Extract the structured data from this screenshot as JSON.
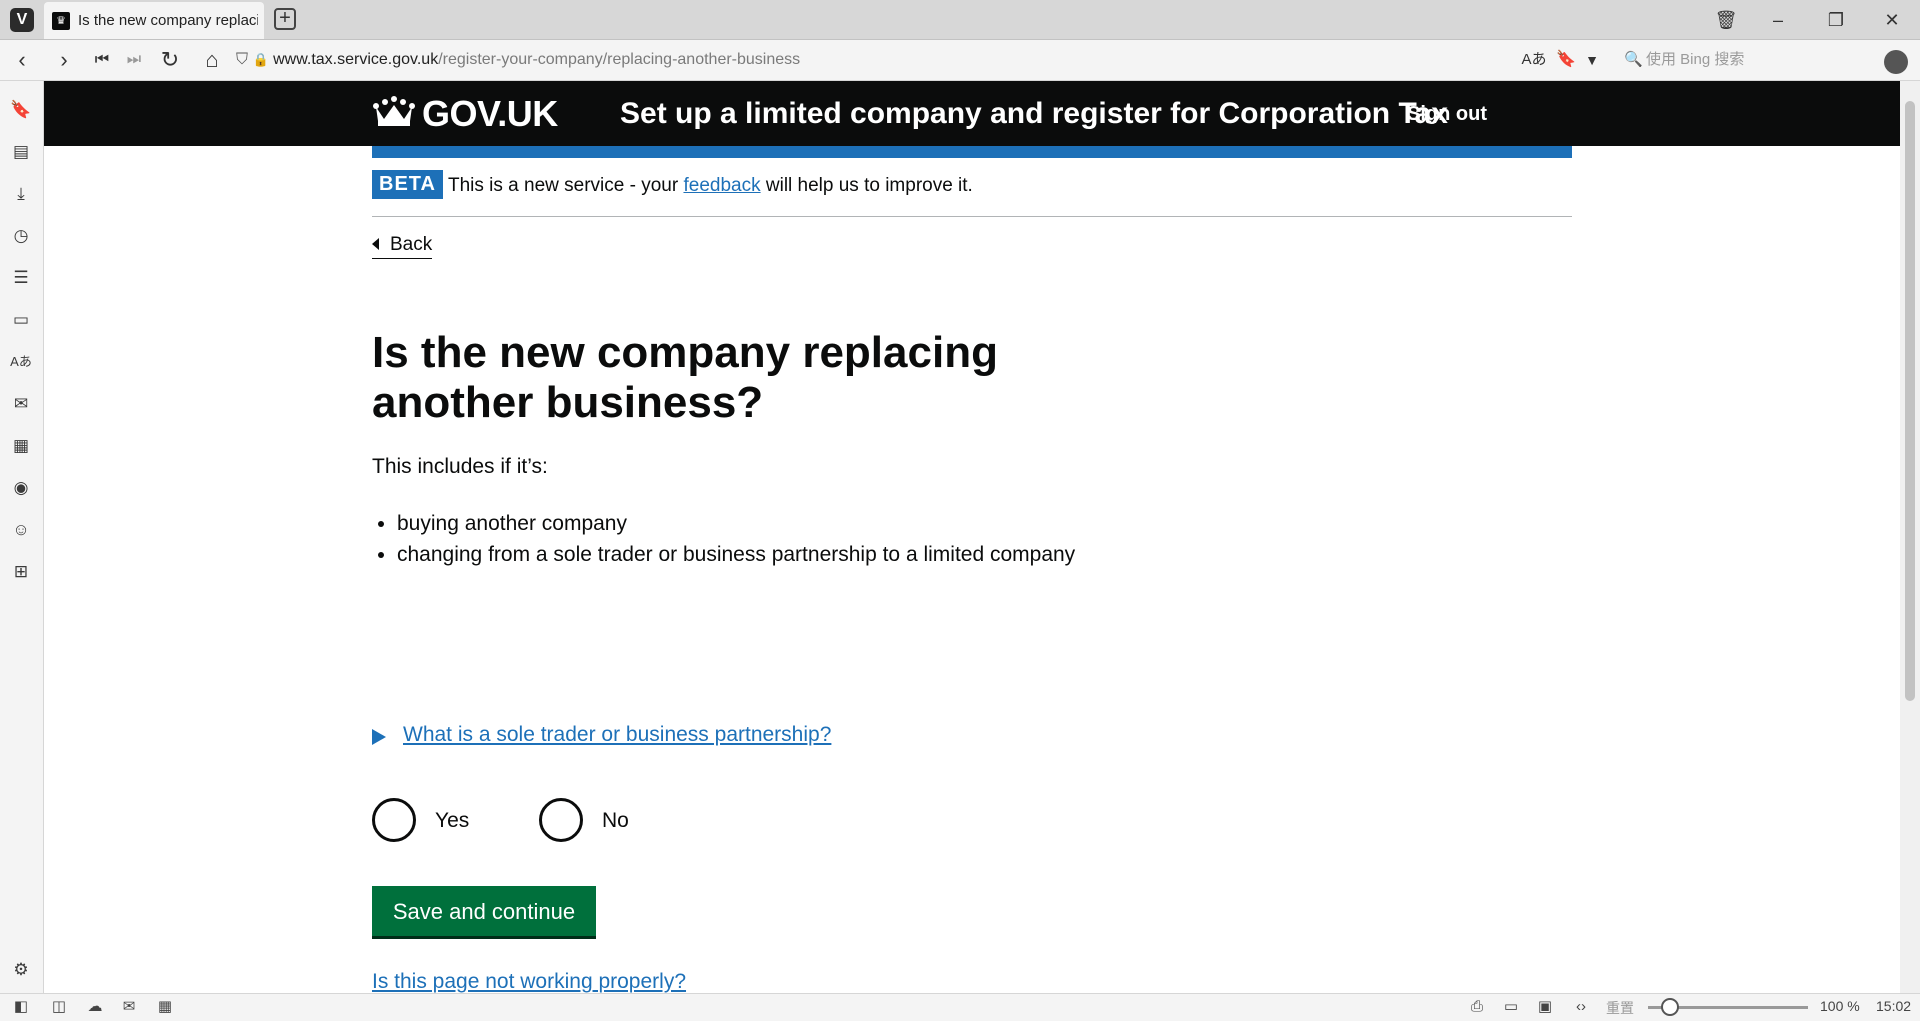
{
  "browser": {
    "tab_title": "Is the new company replaci",
    "url_host": "www.tax.service.gov.uk",
    "url_path": "/register-your-company/replacing-another-business",
    "search_placeholder": "使用 Bing 搜索",
    "statusbar": {
      "reset_label": "重置",
      "zoom": "100 %",
      "time": "15:02",
      "zoom_level": 0.14
    }
  },
  "header": {
    "logotype": "GOV.UK",
    "service_name": "Set up a limited company and register for Corporation Tax",
    "sign_out": "Sign out"
  },
  "phase_banner": {
    "tag": "BETA",
    "text_before": "This is a new service - your ",
    "link": "feedback",
    "text_after": " will help us to improve it."
  },
  "back_link": "Back",
  "question": {
    "heading": "Is the new company replacing another business?",
    "lead": "This includes if it’s:",
    "bullets": [
      "buying another company",
      "changing from a sole trader or business partnership to a limited company"
    ],
    "details_summary": "What is a sole trader or business partnership?",
    "options": [
      "Yes",
      "No"
    ]
  },
  "submit_label": "Save and continue",
  "report_link": "Is this page not working properly?",
  "colors": {
    "header_bg": "#0b0c0c",
    "brand_blue": "#1d70b8",
    "button_green": "#00703c"
  }
}
